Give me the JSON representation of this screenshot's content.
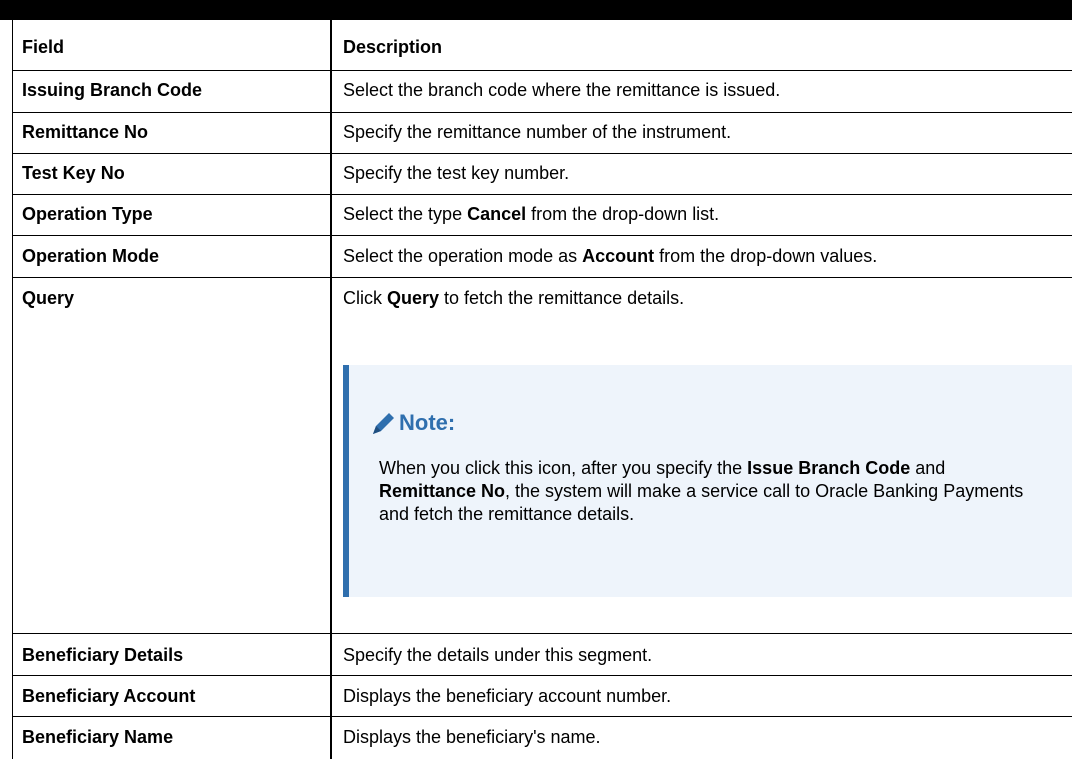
{
  "header": {
    "field": "Field",
    "description": "Description"
  },
  "rows": [
    {
      "field": "Issuing Branch Code",
      "desc": [
        "Select the branch code where the remittance is issued."
      ]
    },
    {
      "field": "Remittance No",
      "desc": [
        "Specify the remittance number of the instrument."
      ]
    },
    {
      "field": "Test Key No",
      "desc": [
        "Specify the test key number."
      ]
    },
    {
      "field": "Operation Type",
      "desc": [
        "Select the type ",
        "Cancel",
        " from the drop-down list."
      ]
    },
    {
      "field": "Operation Mode",
      "desc": [
        "Select the operation mode as ",
        "Account",
        " from the drop-down values."
      ]
    },
    {
      "field": "Query",
      "desc": [
        "Click ",
        "Query",
        " to fetch the remittance details."
      ]
    },
    {
      "field": "Beneficiary Details",
      "desc": [
        "Specify the details under this segment."
      ]
    },
    {
      "field": "Beneficiary Account",
      "desc": [
        "Displays the beneficiary account number."
      ]
    },
    {
      "field": "Beneficiary Name",
      "desc": [
        "Displays the beneficiary's name."
      ]
    }
  ],
  "note": {
    "title": "Note:",
    "icon": "pencil-icon",
    "body": [
      "When you click this icon, after you specify the ",
      "Issue Branch Code",
      " and ",
      "Remittance No",
      ", the system will make a service call to Oracle Banking Payments and fetch the remittance details."
    ]
  }
}
